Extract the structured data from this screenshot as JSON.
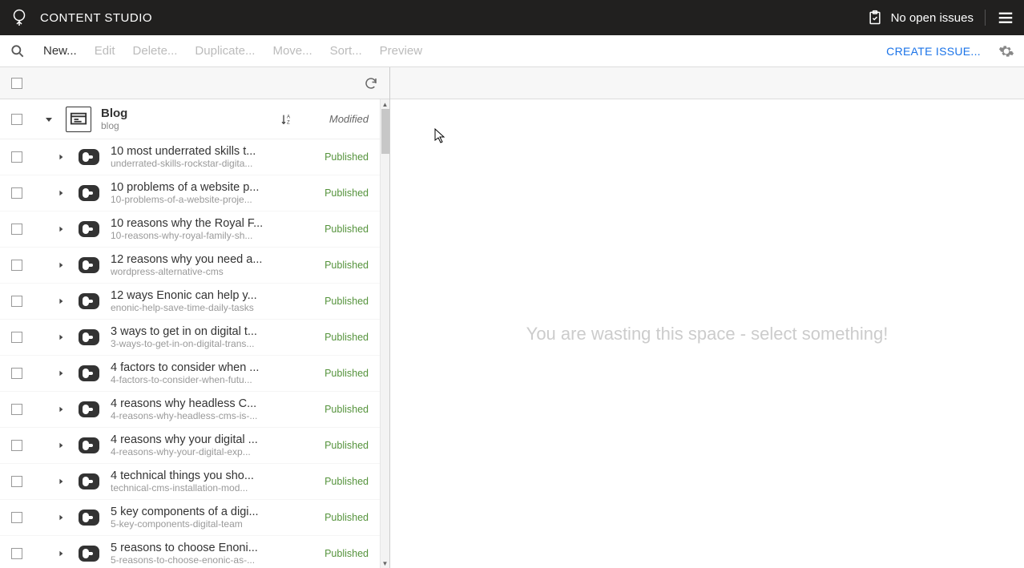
{
  "header": {
    "app_title": "CONTENT STUDIO",
    "issues_label": "No open issues"
  },
  "toolbar": {
    "new": "New...",
    "edit": "Edit",
    "delete": "Delete...",
    "duplicate": "Duplicate...",
    "move": "Move...",
    "sort": "Sort...",
    "preview": "Preview",
    "create_issue": "CREATE ISSUE..."
  },
  "tree": {
    "root": {
      "title": "Blog",
      "path": "blog",
      "state": "Modified"
    },
    "items": [
      {
        "title": "10 most underrated skills t...",
        "path": "underrated-skills-rockstar-digita...",
        "state": "Published"
      },
      {
        "title": "10 problems of a website p...",
        "path": "10-problems-of-a-website-proje...",
        "state": "Published"
      },
      {
        "title": "10 reasons why the Royal F...",
        "path": "10-reasons-why-royal-family-sh...",
        "state": "Published"
      },
      {
        "title": "12 reasons why you need a...",
        "path": "wordpress-alternative-cms",
        "state": "Published"
      },
      {
        "title": "12 ways Enonic can help y...",
        "path": "enonic-help-save-time-daily-tasks",
        "state": "Published"
      },
      {
        "title": "3 ways to get in on digital t...",
        "path": "3-ways-to-get-in-on-digital-trans...",
        "state": "Published"
      },
      {
        "title": "4 factors to consider when ...",
        "path": "4-factors-to-consider-when-futu...",
        "state": "Published"
      },
      {
        "title": "4 reasons why headless C...",
        "path": "4-reasons-why-headless-cms-is-...",
        "state": "Published"
      },
      {
        "title": "4 reasons why your digital ...",
        "path": "4-reasons-why-your-digital-exp...",
        "state": "Published"
      },
      {
        "title": "4 technical things you sho...",
        "path": "technical-cms-installation-mod...",
        "state": "Published"
      },
      {
        "title": "5 key components of a digi...",
        "path": "5-key-components-digital-team",
        "state": "Published"
      },
      {
        "title": "5 reasons to choose Enoni...",
        "path": "5-reasons-to-choose-enonic-as-...",
        "state": "Published"
      }
    ]
  },
  "preview": {
    "placeholder": "You are wasting this space - select something!"
  }
}
